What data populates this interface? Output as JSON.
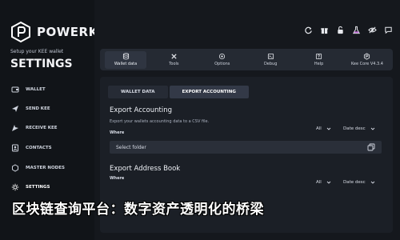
{
  "brand": {
    "name": "POWERKEE"
  },
  "sidebar": {
    "setup_text": "Setup your KEE wallet",
    "title": "SETTINGS",
    "items": [
      {
        "label": "WALLET",
        "icon": "wallet-icon"
      },
      {
        "label": "SEND KEE",
        "icon": "send-icon"
      },
      {
        "label": "RECEIVE KEE",
        "icon": "receive-icon"
      },
      {
        "label": "CONTACTS",
        "icon": "contacts-icon"
      },
      {
        "label": "MASTER NODES",
        "icon": "masternodes-icon"
      },
      {
        "label": "SETTINGS",
        "icon": "settings-icon"
      },
      {
        "label": "",
        "icon": "more-icon"
      }
    ]
  },
  "topbar": {
    "icons": [
      "refresh-icon",
      "gift-icon",
      "unlock-icon",
      "flask-icon",
      "visibility-icon",
      "chat-icon"
    ]
  },
  "settings_nav": {
    "items": [
      {
        "label": "Wallet data",
        "icon": "database-icon",
        "active": true
      },
      {
        "label": "Tools",
        "icon": "tools-icon",
        "active": false
      },
      {
        "label": "Options",
        "icon": "options-icon",
        "active": false
      },
      {
        "label": "Debug",
        "icon": "debug-icon",
        "active": false
      },
      {
        "label": "Help",
        "icon": "help-icon",
        "active": false
      },
      {
        "label": "Kee Core V4.3.4",
        "icon": "core-icon",
        "active": false
      }
    ]
  },
  "wallet_data": {
    "subtabs": [
      {
        "label": "WALLET DATA",
        "active": false
      },
      {
        "label": "EXPORT ACCOUNTING",
        "active": true
      }
    ],
    "export_accounting": {
      "title": "Export Accounting",
      "description": "Export your wallets accounting data to a CSV file.",
      "where_label": "Where",
      "filter_all": "All",
      "filter_date": "Date desc",
      "folder_placeholder": "Select folder"
    },
    "export_address_book": {
      "title": "Export Address Book",
      "where_label": "Where",
      "filter_all": "All",
      "filter_date": "Date desc"
    }
  },
  "watermark": {
    "text": "区块链查询平台：数字资产透明化的桥梁"
  },
  "colors": {
    "background": "#14171c",
    "sidebar": "#111418",
    "panel": "#1b1f26",
    "navstrip": "#252a33",
    "accent": "#ffffff"
  }
}
